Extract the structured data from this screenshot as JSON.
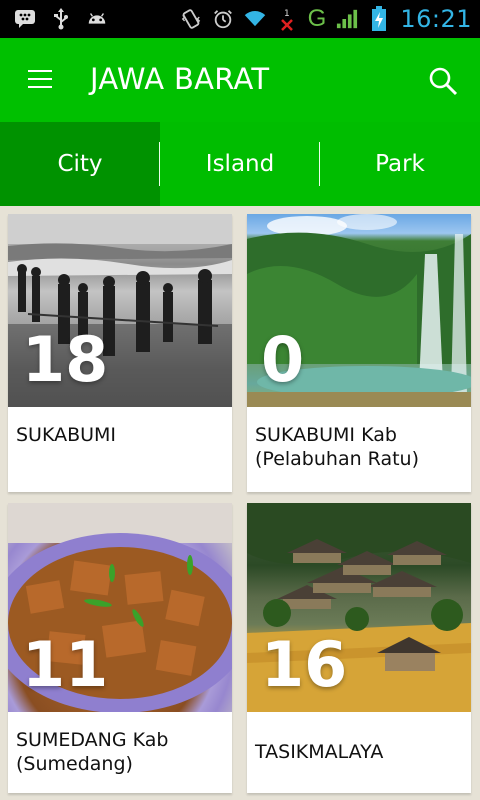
{
  "status_bar": {
    "time": "16:21",
    "network_type": "G",
    "icons_left": [
      "bbm-icon",
      "usb-icon",
      "android-icon"
    ],
    "icons_right": [
      "vibrate-icon",
      "alarm-icon",
      "wifi-icon",
      "no-signal-icon",
      "signal-icon",
      "battery-icon"
    ]
  },
  "action_bar": {
    "title": "JAWA BARAT",
    "menu_icon": "hamburger-icon",
    "search_icon": "search-icon"
  },
  "tabs": [
    {
      "label": "City",
      "active": true
    },
    {
      "label": "Island",
      "active": false
    },
    {
      "label": "Park",
      "active": false
    }
  ],
  "cards": [
    {
      "count": "18",
      "name": "SUKABUMI"
    },
    {
      "count": "0",
      "name": "SUKABUMI Kab (Pelabuhan Ratu)"
    },
    {
      "count": "11",
      "name": "SUMEDANG Kab (Sumedang)"
    },
    {
      "count": "16",
      "name": "TASIKMALAYA"
    }
  ],
  "colors": {
    "primary": "#00c000",
    "tab_active": "#009200",
    "background": "#e6e2d6",
    "clock": "#33b5e5"
  }
}
